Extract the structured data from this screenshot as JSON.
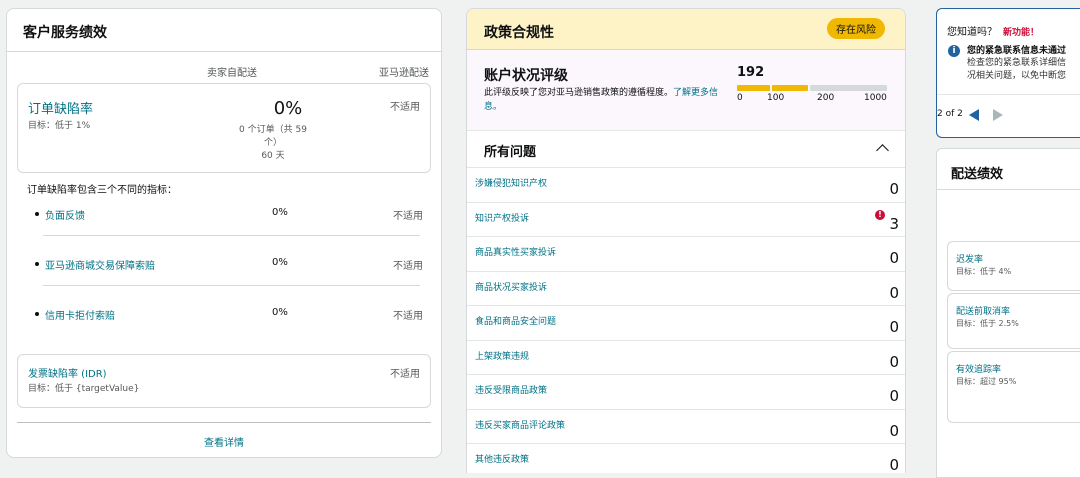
{
  "customer_service": {
    "title": "客户服务绩效",
    "col_seller": "卖家自配送",
    "col_amazon": "亚马逊配送",
    "odr": {
      "title": "订单缺陷率",
      "target": "目标：低于 1%",
      "value": "0%",
      "orders_line1": "0 个订单（共 59",
      "orders_line2": "个）",
      "days": "60 天",
      "amazon": "不适用"
    },
    "intro": "订单缺陷率包含三个不同的指标：",
    "metrics": [
      {
        "label": "负面反馈",
        "value": "0%",
        "amazon": "不适用"
      },
      {
        "label": "亚马逊商城交易保障索赔",
        "value": "0%",
        "amazon": "不适用"
      },
      {
        "label": "信用卡拒付索赔",
        "value": "0%",
        "amazon": "不适用"
      }
    ],
    "idr": {
      "title": "发票缺陷率 (IDR)",
      "target": "目标：低于 {targetValue}",
      "amazon": "不适用"
    },
    "view_details": "查看详情"
  },
  "policy": {
    "title": "政策合规性",
    "badge": "存在风险",
    "ahr": {
      "title": "账户状况评级",
      "desc": "此评级反映了您对亚马逊销售政策的遵循程度。",
      "learn_more": "了解更多信息。",
      "score": "192",
      "score_value": 192,
      "ticks": [
        "0",
        "100",
        "200",
        "1000"
      ],
      "colors": {
        "bad": "#f0b800",
        "neutral": "#d5d9d9"
      }
    },
    "issues_title": "所有问题",
    "issues": [
      {
        "label": "涉嫌侵犯知识产权",
        "count": "0",
        "alert": ""
      },
      {
        "label": "知识产权投诉",
        "count": "3",
        "alert": "!"
      },
      {
        "label": "商品真实性买家投诉",
        "count": "0",
        "alert": ""
      },
      {
        "label": "商品状况买家投诉",
        "count": "0",
        "alert": ""
      },
      {
        "label": "食品和商品安全问题",
        "count": "0",
        "alert": ""
      },
      {
        "label": "上架政策违规",
        "count": "0",
        "alert": ""
      },
      {
        "label": "违反受限商品政策",
        "count": "0",
        "alert": ""
      },
      {
        "label": "违反买家商品评论政策",
        "count": "0",
        "alert": ""
      },
      {
        "label": "其他违反政策",
        "count": "0",
        "alert": ""
      }
    ]
  },
  "tip": {
    "title": "您知道吗？",
    "new_label": "新功能！",
    "icon": "info-icon",
    "icon_glyph": "i",
    "bold": "您的紧急联系信息未通过",
    "line1": "检查您的紧急联系详细信",
    "line2": "况相关问题，以免中断您",
    "pager": "2 of 2"
  },
  "delivery": {
    "title": "配送绩效",
    "metrics": [
      {
        "label": "迟发率",
        "target": "目标：低于 4%"
      },
      {
        "label": "配送前取消率",
        "target": "目标：低于 2.5%"
      },
      {
        "label": "有效追踪率",
        "target": "目标：超过 95%"
      }
    ]
  }
}
